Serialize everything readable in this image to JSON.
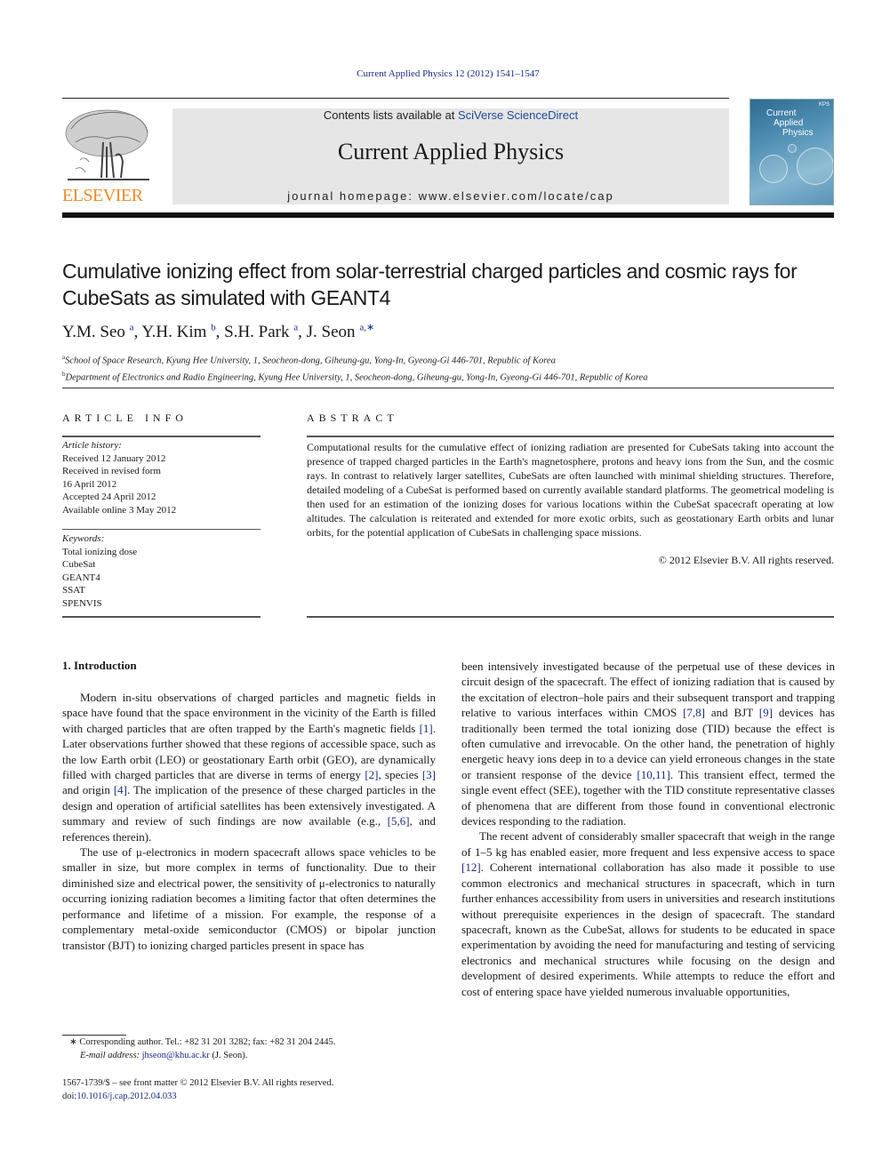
{
  "header": {
    "journal_ref": "Current Applied Physics 12 (2012) 1541–1547",
    "contents_prefix": "Contents lists available at ",
    "contents_link": "SciVerse ScienceDirect",
    "journal_name": "Current Applied Physics",
    "homepage_prefix": "journal homepage: ",
    "homepage_url": "www.elsevier.com/locate/cap",
    "publisher_logo_text": "ELSEVIER",
    "cover": {
      "title_lines": [
        "Current",
        "Applied",
        "Physics"
      ],
      "badge": "KPS"
    }
  },
  "article": {
    "title": "Cumulative ionizing effect from solar-terrestrial charged particles and cosmic rays for CubeSats as simulated with GEANT4",
    "authors": [
      {
        "name": "Y.M. Seo",
        "sup": "a",
        "sep": ", "
      },
      {
        "name": "Y.H. Kim",
        "sup": "b",
        "sep": ", "
      },
      {
        "name": "S.H. Park",
        "sup": "a",
        "sep": ", "
      },
      {
        "name": "J. Seon",
        "sup": "a,∗",
        "sep": ""
      }
    ],
    "affiliations": [
      {
        "mark": "a",
        "text": "School of Space Research, Kyung Hee University, 1, Seocheon-dong, Giheung-gu, Yong-In, Gyeong-Gi 446-701, Republic of Korea"
      },
      {
        "mark": "b",
        "text": "Department of Electronics and Radio Engineering, Kyung Hee University, 1, Seocheon-dong, Giheung-gu, Yong-In, Gyeong-Gi 446-701, Republic of Korea"
      }
    ]
  },
  "article_info": {
    "heading": "ARTICLE INFO",
    "history_label": "Article history:",
    "history": [
      "Received 12 January 2012",
      "Received in revised form",
      "16 April 2012",
      "Accepted 24 April 2012",
      "Available online 3 May 2012"
    ],
    "keywords_label": "Keywords:",
    "keywords": [
      "Total ionizing dose",
      "CubeSat",
      "GEANT4",
      "SSAT",
      "SPENVIS"
    ]
  },
  "abstract": {
    "heading": "ABSTRACT",
    "text": "Computational results for the cumulative effect of ionizing radiation are presented for CubeSats taking into account the presence of trapped charged particles in the Earth's magnetosphere, protons and heavy ions from the Sun, and the cosmic rays. In contrast to relatively larger satellites, CubeSats are often launched with minimal shielding structures. Therefore, detailed modeling of a CubeSat is performed based on currently available standard platforms. The geometrical modeling is then used for an estimation of the ionizing doses for various locations within the CubeSat spacecraft operating at low altitudes. The calculation is reiterated and extended for more exotic orbits, such as geostationary Earth orbits and lunar orbits, for the potential application of CubeSats in challenging space missions.",
    "copyright": "© 2012 Elsevier B.V. All rights reserved."
  },
  "body": {
    "section_heading": "1.  Introduction",
    "left_paragraphs": [
      [
        {
          "t": "Modern in-situ observations of charged particles and magnetic fields in space have found that the space environment in the vicinity of the Earth is filled with charged particles that are often trapped by the Earth's magnetic fields "
        },
        {
          "ref": "[1]"
        },
        {
          "t": ". Later observations further showed that these regions of accessible space, such as the low Earth orbit (LEO) or geostationary Earth orbit (GEO), are dynamically filled with charged particles that are diverse in terms of energy "
        },
        {
          "ref": "[2]"
        },
        {
          "t": ", species "
        },
        {
          "ref": "[3]"
        },
        {
          "t": " and origin "
        },
        {
          "ref": "[4]"
        },
        {
          "t": ". The implication of the presence of these charged particles in the design and operation of artificial satellites has been extensively investigated. A summary and review of such findings are now available (e.g., "
        },
        {
          "ref": "[5,6]"
        },
        {
          "t": ", and references therein)."
        }
      ],
      [
        {
          "t": "The use of μ-electronics in modern spacecraft allows space vehicles to be smaller in size, but more complex in terms of functionality. Due to their diminished size and electrical power, the sensitivity of μ-electronics to naturally occurring ionizing radiation becomes a limiting factor that often determines the performance and lifetime of a mission. For example, the response of a complementary metal-oxide semiconductor (CMOS) or bipolar junction transistor (BJT) to ionizing charged particles present in space has"
        }
      ]
    ],
    "right_paragraphs": [
      [
        {
          "t": "been intensively investigated because of the perpetual use of these devices in circuit design of the spacecraft. The effect of ionizing radiation that is caused by the excitation of electron–hole pairs and their subsequent transport and trapping relative to various interfaces within CMOS "
        },
        {
          "ref": "[7,8]"
        },
        {
          "t": " and BJT "
        },
        {
          "ref": "[9]"
        },
        {
          "t": " devices has traditionally been termed the total ionizing dose (TID) because the effect is often cumulative and irrevocable. On the other hand, the penetration of highly energetic heavy ions deep in to a device can yield erroneous changes in the state or transient response of the device "
        },
        {
          "ref": "[10,11]"
        },
        {
          "t": ". This transient effect, termed the single event effect (SEE), together with the TID constitute representative classes of phenomena that are different from those found in conventional electronic devices responding to the radiation."
        }
      ],
      [
        {
          "t": "The recent advent of considerably smaller spacecraft that weigh in the range of 1–5 kg has enabled easier, more frequent and less expensive access to space "
        },
        {
          "ref": "[12]"
        },
        {
          "t": ". Coherent international collaboration has also made it possible to use common electronics and mechanical structures in spacecraft, which in turn further enhances accessibility from users in universities and research institutions without prerequisite experiences in the design of spacecraft. The standard spacecraft, known as the CubeSat, allows for students to be educated in space experimentation by avoiding the need for manufacturing and testing of servicing electronics and mechanical structures while focusing on the design and development of desired experiments. While attempts to reduce the effort and cost of entering space have yielded numerous invaluable opportunities,"
        }
      ]
    ]
  },
  "footnotes": {
    "corresponding": "∗  Corresponding author. Tel.: +82 31 201 3282; fax: +82 31 204 2445.",
    "email_label": "E-mail address: ",
    "email": "jhseon@khu.ac.kr",
    "email_suffix": " (J. Seon).",
    "issn_line": "1567-1739/$ – see front matter © 2012 Elsevier B.V. All rights reserved.",
    "doi_label": "doi:",
    "doi": "10.1016/j.cap.2012.04.033"
  },
  "colors": {
    "link": "#1c2a7c",
    "elsevier_orange": "#f08a24",
    "masthead_bg": "#e6e6e6"
  }
}
